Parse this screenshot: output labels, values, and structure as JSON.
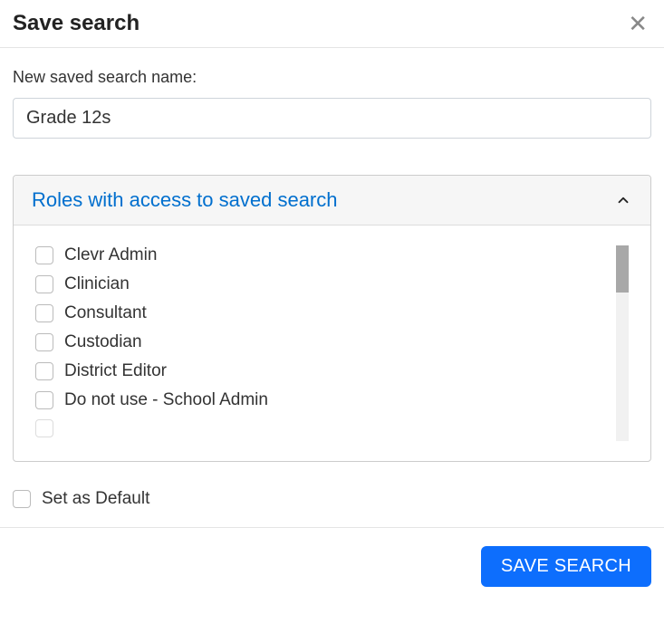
{
  "header": {
    "title": "Save search"
  },
  "form": {
    "name_label": "New saved search name:",
    "name_value": "Grade 12s",
    "default_label": "Set as Default"
  },
  "accordion": {
    "title": "Roles with access to saved search",
    "expanded": true
  },
  "roles": [
    {
      "label": "Clevr Admin",
      "checked": false
    },
    {
      "label": "Clinician",
      "checked": false
    },
    {
      "label": "Consultant",
      "checked": false
    },
    {
      "label": "Custodian",
      "checked": false
    },
    {
      "label": "District Editor",
      "checked": false
    },
    {
      "label": "Do not use - School Admin",
      "checked": false
    }
  ],
  "footer": {
    "save_label": "SAVE SEARCH"
  }
}
